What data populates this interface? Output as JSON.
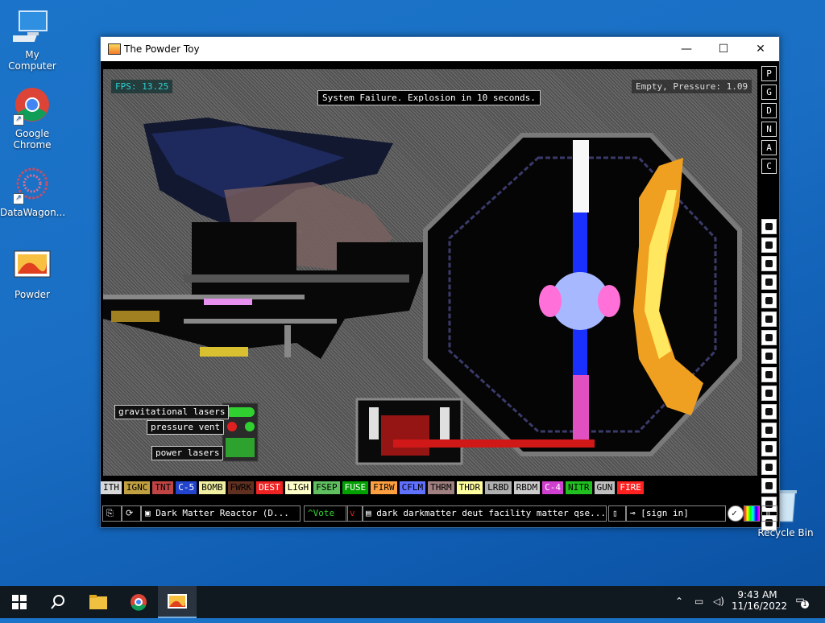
{
  "desktop": {
    "icons": [
      {
        "label": "My Computer",
        "icon": "computer-icon"
      },
      {
        "label": "Google Chrome",
        "icon": "chrome-icon"
      },
      {
        "label": "DataWagon...",
        "icon": "datawagon-icon"
      },
      {
        "label": "Powder",
        "icon": "powder-icon"
      },
      {
        "label": "Recycle Bin",
        "icon": "recycle-bin-icon"
      }
    ]
  },
  "window": {
    "title": "The Powder Toy",
    "controls": {
      "minimize": "—",
      "maximize": "☐",
      "close": "✕"
    }
  },
  "game": {
    "fps": "FPS: 13.25",
    "status": "Empty, Pressure: 1.09",
    "message": "System Failure. Explosion in 10 seconds.",
    "mode_buttons": [
      "P",
      "G",
      "D",
      "N",
      "A",
      "C"
    ],
    "labels": {
      "grav_lasers": "gravitational lasers",
      "pressure_vent": "pressure vent",
      "power_lasers": "power lasers"
    },
    "elements": [
      {
        "name": "ITH",
        "bg": "#d8d8d8",
        "fg": "#000"
      },
      {
        "name": "IGNC",
        "bg": "#c0a040",
        "fg": "#000"
      },
      {
        "name": "TNT",
        "bg": "#c04444",
        "fg": "#000"
      },
      {
        "name": "C-5",
        "bg": "#2244cc",
        "fg": "#fff"
      },
      {
        "name": "BOMB",
        "bg": "#f0f0a0",
        "fg": "#000"
      },
      {
        "name": "FWRK",
        "bg": "#603020",
        "fg": "#000"
      },
      {
        "name": "DEST",
        "bg": "#ee2222",
        "fg": "#fff"
      },
      {
        "name": "LIGH",
        "bg": "#ffffc8",
        "fg": "#000"
      },
      {
        "name": "FSEP",
        "bg": "#60c060",
        "fg": "#000"
      },
      {
        "name": "FUSE",
        "bg": "#00a000",
        "fg": "#fff"
      },
      {
        "name": "FIRW",
        "bg": "#ffa040",
        "fg": "#000"
      },
      {
        "name": "CFLM",
        "bg": "#6070ff",
        "fg": "#000"
      },
      {
        "name": "THRM",
        "bg": "#a08080",
        "fg": "#000"
      },
      {
        "name": "THDR",
        "bg": "#ffffa0",
        "fg": "#000"
      },
      {
        "name": "LRBD",
        "bg": "#b0b0b0",
        "fg": "#000"
      },
      {
        "name": "RBDM",
        "bg": "#cccccc",
        "fg": "#000"
      },
      {
        "name": "C-4",
        "bg": "#d040d0",
        "fg": "#fff"
      },
      {
        "name": "NITR",
        "bg": "#20c020",
        "fg": "#000"
      },
      {
        "name": "GUN",
        "bg": "#c0c0c0",
        "fg": "#000"
      },
      {
        "name": "FIRE",
        "bg": "#ff2020",
        "fg": "#fff"
      }
    ],
    "bottombar": {
      "save_name": "Dark Matter Reactor (D...",
      "vote": "Vote",
      "tags": "dark darkmatter deut facility matter qse...",
      "login": "[sign in]"
    }
  },
  "taskbar": {
    "time": "9:43 AM",
    "date": "11/16/2022",
    "notification_count": "1"
  }
}
